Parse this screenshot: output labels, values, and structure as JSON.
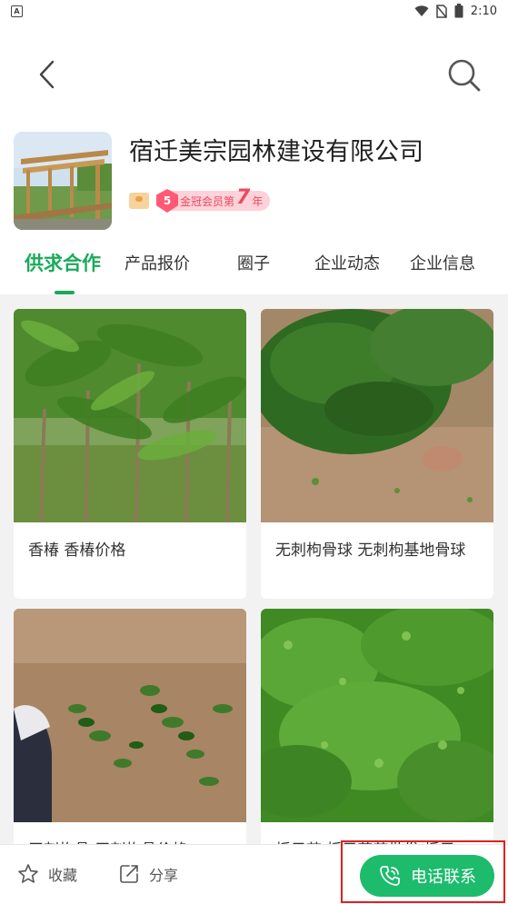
{
  "status_bar": {
    "left_icon_letter": "A",
    "time": "2:10"
  },
  "company": {
    "name": "宿迁美宗园林建设有限公司",
    "member_level": "5",
    "member_text": "金冠会员第",
    "member_years": "7",
    "member_unit": "年"
  },
  "tabs": [
    {
      "label": "供求合作",
      "active": true
    },
    {
      "label": "产品报价",
      "active": false
    },
    {
      "label": "圈子",
      "active": false
    },
    {
      "label": "企业动态",
      "active": false
    },
    {
      "label": "企业信息",
      "active": false
    }
  ],
  "products": [
    {
      "title": "香椿 香椿价格"
    },
    {
      "title": "无刺枸骨球 无刺枸基地骨球"
    },
    {
      "title": "无刺枸骨 无刺枸骨价格"
    },
    {
      "title": "栀子苗 栀子花苗批发 栀子"
    }
  ],
  "bottom_bar": {
    "favorite_label": "收藏",
    "share_label": "分享",
    "call_label": "电话联系"
  },
  "colors": {
    "accent": "#1aaa5a",
    "call_button": "#1dbb6c",
    "member_pink": "#e84b63",
    "highlight": "#e02020"
  }
}
